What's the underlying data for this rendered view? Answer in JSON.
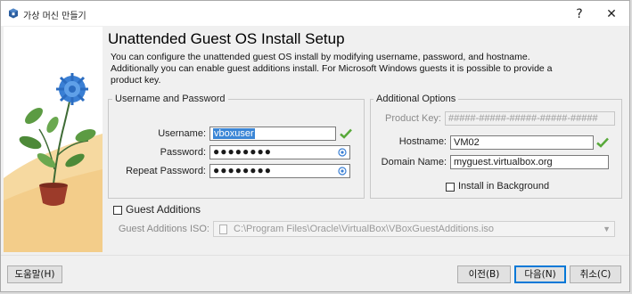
{
  "window": {
    "title": "가상 머신 만들기",
    "help_glyph": "?",
    "close_glyph": "✕"
  },
  "page": {
    "heading": "Unattended Guest OS Install Setup",
    "description": "You can configure the unattended guest OS install by modifying username, password, and hostname. Additionally you can enable guest additions install. For Microsoft Windows guests it is possible to provide a product key."
  },
  "credentials": {
    "group_title": "Username and Password",
    "username_label": "Username:",
    "username_value": "vboxuser",
    "password_label": "Password:",
    "password_value": "●●●●●●●●",
    "repeat_password_label": "Repeat Password:",
    "repeat_password_value": "●●●●●●●●"
  },
  "additional": {
    "group_title": "Additional Options",
    "product_key_label": "Product Key:",
    "product_key_placeholder": "#####-#####-#####-#####-#####",
    "hostname_label": "Hostname:",
    "hostname_value": "VM02",
    "domain_label": "Domain Name:",
    "domain_value": "myguest.virtualbox.org",
    "install_bg_label": "Install in Background",
    "install_bg_checked": false
  },
  "guest_additions": {
    "label": "Guest Additions",
    "checked": false,
    "iso_label": "Guest Additions ISO:",
    "iso_path": "C:\\Program Files\\Oracle\\VirtualBox\\VBoxGuestAdditions.iso"
  },
  "footer": {
    "help_button": "도움말(H)",
    "back_button": "이전(B)",
    "next_button": "다음(N)",
    "cancel_button": "취소(C)"
  },
  "colors": {
    "accent": "#0078d7",
    "ok_check": "#58a93a",
    "selection": "#3b86d6"
  }
}
